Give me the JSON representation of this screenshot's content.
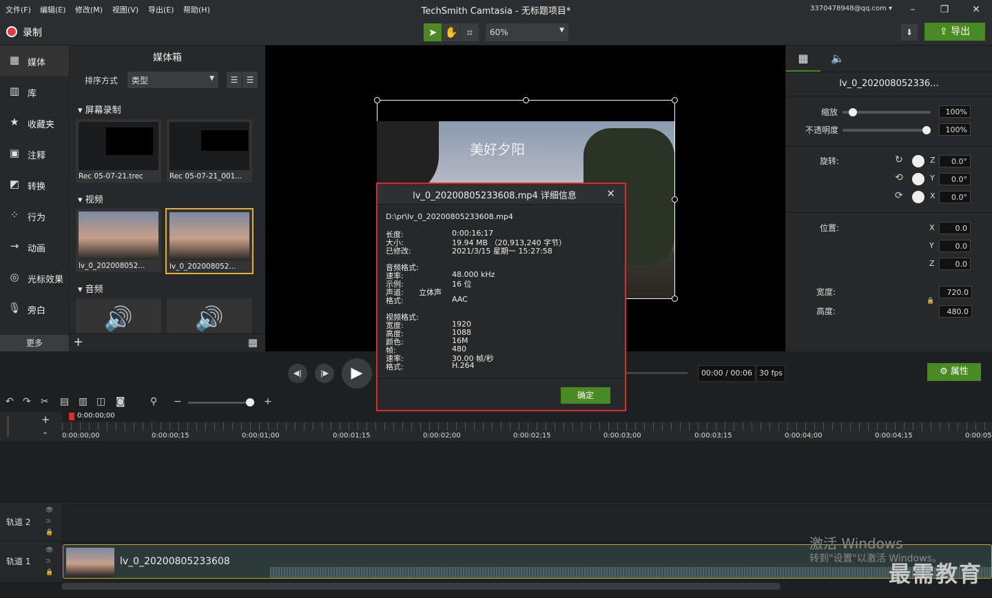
{
  "menubar": {
    "items": [
      "文件(F)",
      "编辑(E)",
      "修改(M)",
      "视图(V)",
      "导出(E)",
      "帮助(H)"
    ],
    "title": "TechSmith Camtasia - 无标题项目*",
    "user": "3370478948@qq.com ▾"
  },
  "toolbar": {
    "record": "录制",
    "zoom": "60%",
    "export": "导出"
  },
  "sidebar": {
    "items": [
      "媒体",
      "库",
      "收藏夹",
      "注释",
      "转换",
      "行为",
      "动画",
      "光标效果",
      "旁白"
    ],
    "more": "更多"
  },
  "mediabin": {
    "title": "媒体箱",
    "sort_label": "排序方式",
    "sort_value": "类型",
    "sections": [
      "屏幕录制",
      "视频",
      "音频"
    ],
    "recordings": [
      "Rec 05-07-21.trec",
      "Rec 05-07-21_001..."
    ],
    "videos": [
      "lv_0_202008052...",
      "lv_0_202008052..."
    ]
  },
  "canvas": {
    "overlay_text": "美好夕阳"
  },
  "props": {
    "clip_title": "lv_0_202008052336...",
    "scale_label": "缩放",
    "scale": "100%",
    "opacity_label": "不透明度",
    "opacity": "100%",
    "rotation_label": "旋转:",
    "rot_z": "0.0°",
    "rot_y": "0.0°",
    "rot_x": "0.0°",
    "position_label": "位置:",
    "pos_x": "0.0",
    "pos_y": "0.0",
    "pos_z": "0.0",
    "width_label": "宽度:",
    "width": "720.0",
    "height_label": "高度:",
    "height": "480.0",
    "axes": [
      "Z",
      "Y",
      "X"
    ],
    "pos_axes": [
      "X",
      "Y",
      "Z"
    ],
    "scale_level": 0.08,
    "opacity_level": 1.0
  },
  "transport": {
    "time": "00:00 / 00:06",
    "fps": "30 fps",
    "props_button": "属性"
  },
  "timeline": {
    "playhead": "0:00:00;00",
    "ticks": [
      "0:00:00;00",
      "0:00:00;15",
      "0:00:01;00",
      "0:00:01;15",
      "0:00:02;00",
      "0:00:02;15",
      "0:00:03;00",
      "0:00:03;15",
      "0:00:04;00",
      "0:00:04;15",
      "0:00:05"
    ],
    "track2": "轨道 2",
    "track1": "轨道 1",
    "clip_name": "lv_0_20200805233608"
  },
  "dialog": {
    "title": "lv_0_20200805233608.mp4 详细信息",
    "path": "D:\\pr\\lv_0_20200805233608.mp4",
    "length_label": "长度:",
    "length": "0:00:16;17",
    "size_label": "大小:",
    "size": "19.94 MB （20,913,240 字节）",
    "modified_label": "已修改:",
    "modified": "2021/3/15 星期一 15:27:58",
    "audio_label": "音频格式:",
    "rate_label": "速率:",
    "rate": "48.000 kHz",
    "sample_label": "示例:",
    "sample": "16 位",
    "channel_label": "声道:",
    "channel": "立体声",
    "aformat_label": "格式:",
    "aformat": "AAC",
    "video_label": "视频格式:",
    "vwidth_label": "宽度:",
    "vwidth": "1920",
    "vheight_label": "高度:",
    "vheight": "1088",
    "color_label": "颜色:",
    "color": "16M",
    "frames_label": "帧:",
    "frames": "480",
    "vrate_label": "速率:",
    "vrate": "30.00 帧/秒",
    "vformat_label": "格式:",
    "vformat": "H.264",
    "ok": "确定"
  },
  "watermark": {
    "line1": "激活 Windows",
    "line2": "转到\"设置\"以激活 Windows。",
    "logo": "最需教育"
  },
  "colors": {
    "accent_green": "#4a8a22",
    "highlight_red": "#e02b2b",
    "selected_yellow": "#e8b032"
  }
}
